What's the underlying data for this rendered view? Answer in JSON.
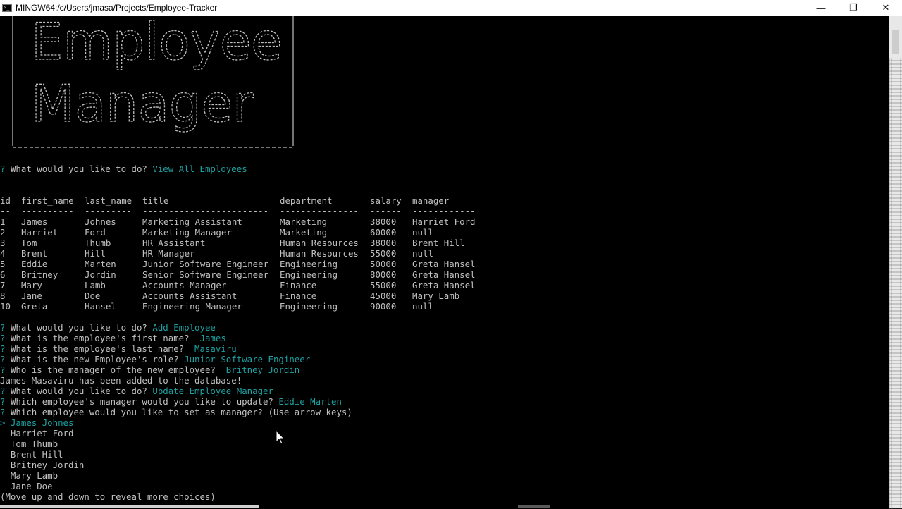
{
  "window": {
    "title": "MINGW64:/c/Users/jmasa/Projects/Employee-Tracker",
    "minimize": "—",
    "restore": "❐",
    "close": "✕"
  },
  "banner": {
    "line1": "Employee",
    "line2": "Manager"
  },
  "prompts": {
    "q1": "What would you like to do?",
    "a1": "View All Employees",
    "q2": "What would you like to do?",
    "a2": "Add Employee",
    "q3": "What is the employee's first name?",
    "a3": "James",
    "q4": "What is the employee's last name?",
    "a4": "Masaviru",
    "q5": "What is the new Employee's role?",
    "a5": "Junior Software Engineer",
    "q6": "Who is the manager of the new employee?",
    "a6": "Britney Jordin",
    "msg": "James Masaviru has been added to the database!",
    "q7": "What would you like to do?",
    "a7": "Update Employee Manager",
    "q8": "Which employee's manager would you like to update?",
    "a8": "Eddie Marten",
    "q9": "Which employee would you like to set as manager?",
    "hint": "(Use arrow keys)",
    "footer": "(Move up and down to reveal more choices)"
  },
  "table": {
    "headers": [
      "id",
      "first_name",
      "last_name",
      "title",
      "department",
      "salary",
      "manager"
    ],
    "separators": [
      "--",
      "----------",
      "---------",
      "------------------------",
      "---------------",
      "------",
      "------------"
    ],
    "rows": [
      [
        "1",
        "James",
        "Johnes",
        "Marketing Assistant",
        "Marketing",
        "38000",
        "Harriet Ford"
      ],
      [
        "2",
        "Harriet",
        "Ford",
        "Marketing Manager",
        "Marketing",
        "60000",
        "null"
      ],
      [
        "3",
        "Tom",
        "Thumb",
        "HR Assistant",
        "Human Resources",
        "38000",
        "Brent Hill"
      ],
      [
        "4",
        "Brent",
        "Hill",
        "HR Manager",
        "Human Resources",
        "55000",
        "null"
      ],
      [
        "5",
        "Eddie",
        "Marten",
        "Junior Software Engineer",
        "Engineering",
        "50000",
        "Greta Hansel"
      ],
      [
        "6",
        "Britney",
        "Jordin",
        "Senior Software Engineer",
        "Engineering",
        "80000",
        "Greta Hansel"
      ],
      [
        "7",
        "Mary",
        "Lamb",
        "Accounts Manager",
        "Finance",
        "55000",
        "Greta Hansel"
      ],
      [
        "8",
        "Jane",
        "Doe",
        "Accounts Assistant",
        "Finance",
        "45000",
        "Mary Lamb"
      ],
      [
        "10",
        "Greta",
        "Hansel",
        "Engineering Manager",
        "Engineering",
        "90000",
        "null"
      ]
    ]
  },
  "choices": {
    "pointer": ">",
    "selected": "James Johnes",
    "items": [
      "Harriet Ford",
      "Tom Thumb",
      "Brent Hill",
      "Britney Jordin",
      "Mary Lamb",
      "Jane Doe"
    ]
  },
  "colors": {
    "accent": "#1ea0a0",
    "text": "#c0c0c0",
    "background": "#000000"
  }
}
